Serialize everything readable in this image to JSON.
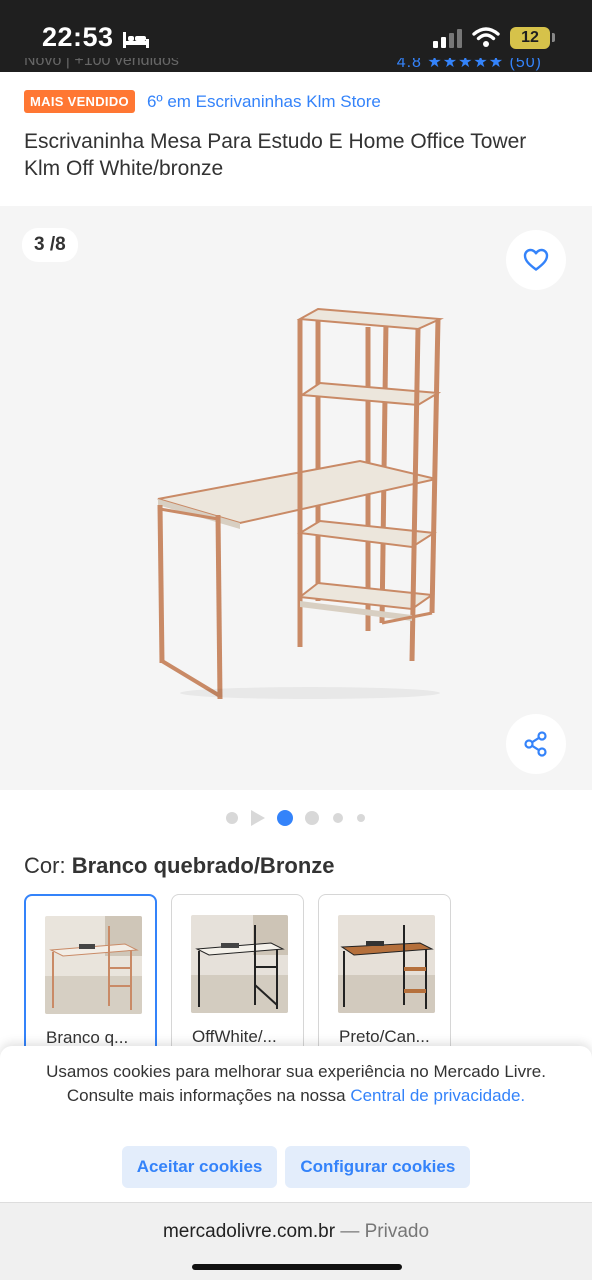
{
  "status_bar": {
    "time": "22:53",
    "battery": "12"
  },
  "clipped": {
    "left": "Novo | +100 vendidos",
    "right": "4.8 ★★★★★ (50)"
  },
  "badge": {
    "label": "MAIS VENDIDO",
    "ranking": "6º em Escrivaninhas Klm Store"
  },
  "product": {
    "title": "Escrivaninha Mesa Para Estudo E Home Office Tower Klm Off White/bronze"
  },
  "gallery": {
    "counter": "3 /8",
    "current_index": 3,
    "total": 8
  },
  "color": {
    "label": "Cor:",
    "selected": "Branco quebrado/Bronze",
    "variants": [
      {
        "label": "Branco q..."
      },
      {
        "label": "OffWhite/..."
      },
      {
        "label": "Preto/Can..."
      }
    ]
  },
  "cookies": {
    "text": "Usamos cookies para melhorar sua experiência no Mercado Livre. Consulte mais informações na nossa ",
    "link": "Central de privacidade.",
    "accept": "Aceitar cookies",
    "configure": "Configurar cookies"
  },
  "address_bar": {
    "domain": "mercadolivre.com.br",
    "separator": " — ",
    "mode": "Privado"
  },
  "colors": {
    "accent": "#3483fa",
    "badge": "#ff7733",
    "frame_bronze": "#c98a66",
    "wood_offwhite": "#ece6dc"
  }
}
